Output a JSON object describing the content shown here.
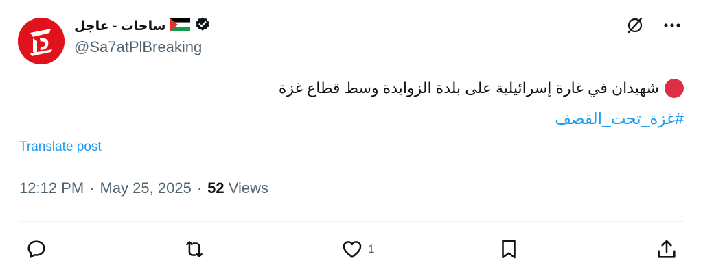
{
  "account": {
    "display_name": "ساحات - عاجل",
    "handle": "@Sa7atPlBreaking"
  },
  "tweet": {
    "text": "شهيدان في غارة إسرائيلية على بلدة الزوايدة وسط قطاع غزة",
    "hashtag": "#غزة_تحت_القصف",
    "translate_label": "Translate post",
    "time": "12:12 PM",
    "date": "May 25, 2025",
    "views_count": "52",
    "views_label": "Views"
  },
  "actions": {
    "likes_count": "1"
  },
  "colors": {
    "accent": "#1d9bf0",
    "avatar_bg": "#e0121c",
    "secondary_text": "#536471"
  },
  "icons": [
    "verified-badge-icon",
    "palestine-flag-icon",
    "grok-icon",
    "more-icon",
    "reply-icon",
    "repost-icon",
    "like-icon",
    "bookmark-icon",
    "share-icon"
  ]
}
